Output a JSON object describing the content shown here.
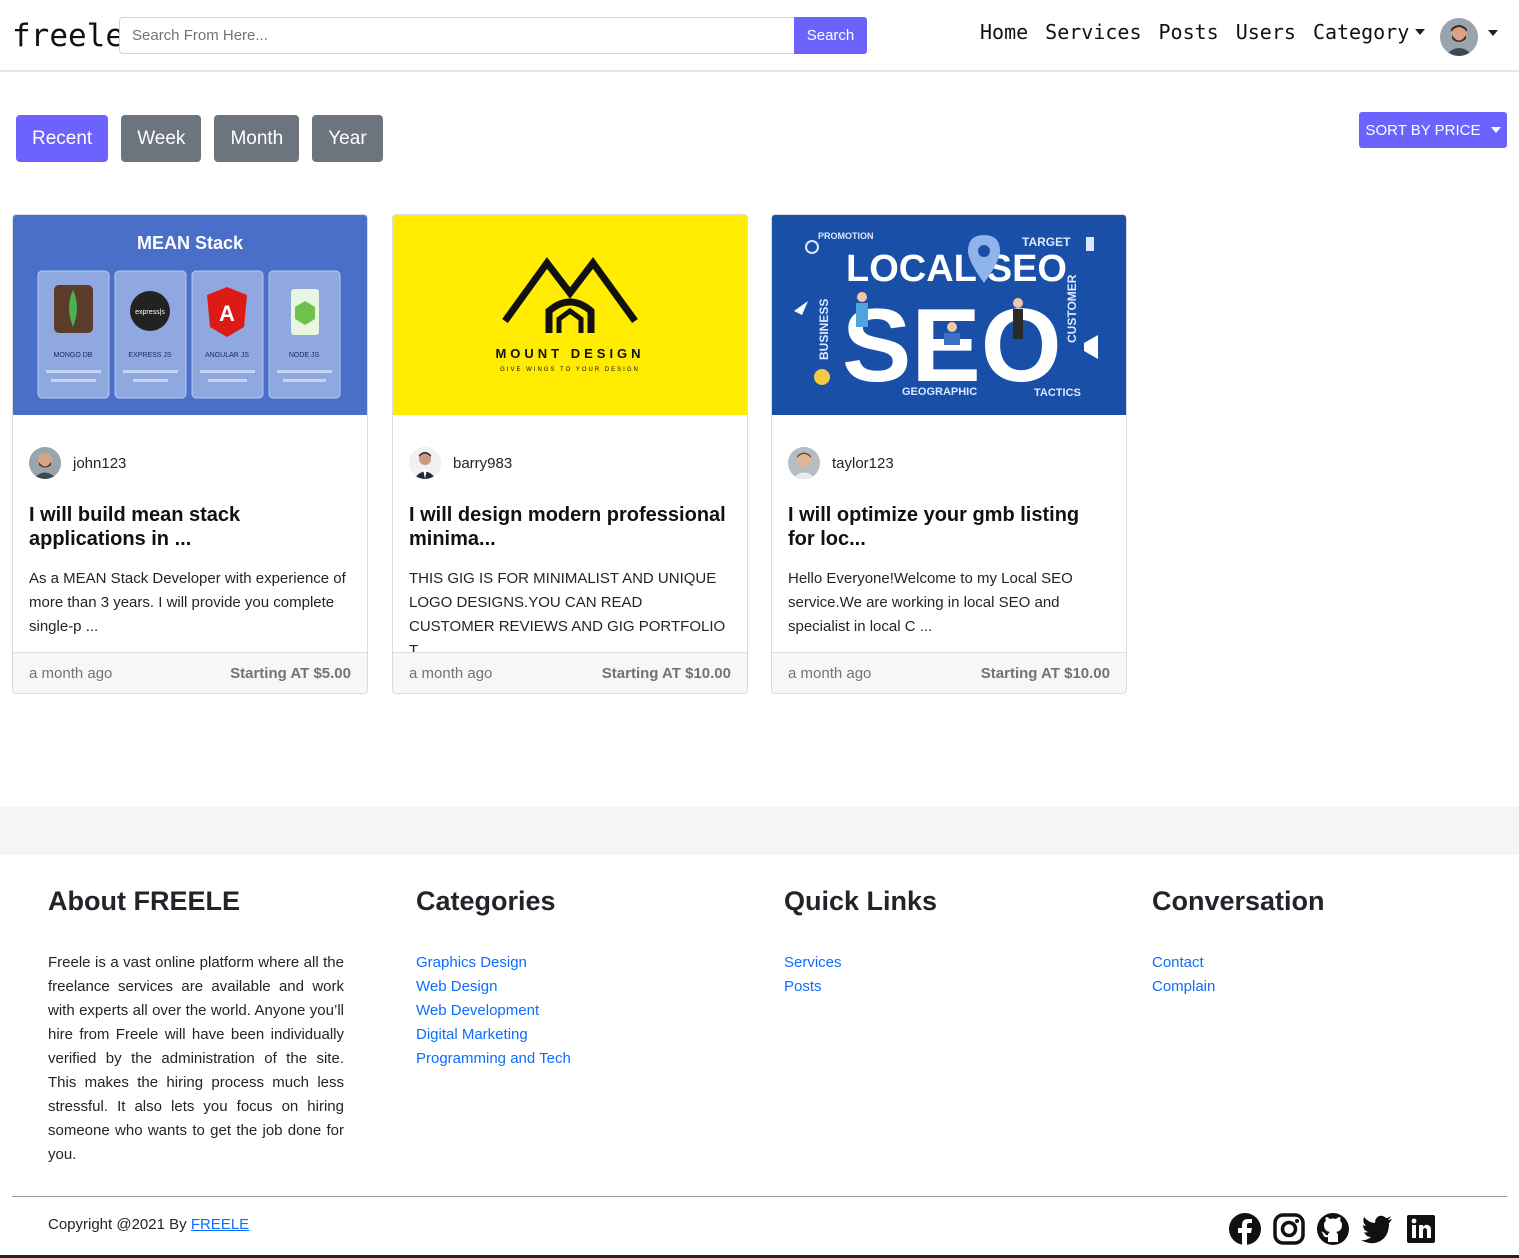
{
  "navbar": {
    "brand": "freele",
    "search_placeholder": "Search From Here...",
    "search_button": "Search",
    "links": [
      "Home",
      "Services",
      "Posts",
      "Users"
    ],
    "category_label": "Category"
  },
  "filters": {
    "buttons": [
      "Recent",
      "Week",
      "Month",
      "Year"
    ],
    "active": "Recent",
    "sort_label": "SORT BY PRICE"
  },
  "cards": [
    {
      "image_caption": "MEAN Stack",
      "image_items": [
        "MONGO DB",
        "EXPRESS JS",
        "ANGULAR JS",
        "NODE JS"
      ],
      "seller": "john123",
      "title": "I will build mean stack applications in ...",
      "description": "As a MEAN Stack Developer with experience of more than 3 years. I will provide you complete single-p ...",
      "time": "a month ago",
      "price": "Starting AT $5.00"
    },
    {
      "image_caption": "MOUNT DESIGN",
      "image_subcaption": "GIVE WINGS TO YOUR DESIGN",
      "seller": "barry983",
      "title": "I will design modern professional minima...",
      "description": "THIS GIG IS FOR MINIMALIST AND UNIQUE LOGO DESIGNS.YOU CAN READ CUSTOMER REVIEWS AND GIG PORTFOLIO T ...",
      "time": "a month ago",
      "price": "Starting AT $10.00"
    },
    {
      "image_caption": "LOCAL SEO",
      "image_words": [
        "PROMOTION",
        "TARGET",
        "BUSINESS",
        "CUSTOMER",
        "GEOGRAPHIC",
        "TACTICS"
      ],
      "seller": "taylor123",
      "title": "I will optimize your gmb listing for loc...",
      "description": "Hello Everyone!Welcome to my Local SEO service.We are working in local SEO and specialist in local C ...",
      "time": "a month ago",
      "price": "Starting AT $10.00"
    }
  ],
  "footer": {
    "about_title": "About FREELE",
    "about_text": "Freele is a vast online platform where all the freelance services are available and work with experts all over the world. Anyone you’ll hire from Freele will have been individually verified by the administration of the site. This makes the hiring process much less stressful. It also lets you focus on hiring someone who wants to get the job done for you.",
    "categories_title": "Categories",
    "categories": [
      "Graphics Design",
      "Web Design",
      "Web Development",
      "Digital Marketing",
      "Programming and Tech"
    ],
    "quick_title": "Quick Links",
    "quick_links": [
      "Services",
      "Posts"
    ],
    "conv_title": "Conversation",
    "conv_links": [
      "Contact",
      "Complain"
    ],
    "copyright_prefix": "Copyright @2021 By ",
    "copyright_link": "FREELE",
    "social_icons": [
      "facebook-icon",
      "instagram-icon",
      "github-icon",
      "twitter-icon",
      "linkedin-icon"
    ]
  },
  "colors": {
    "accent": "#6c63ff",
    "secondary": "#6c757d",
    "link": "#0d6efd",
    "card_mean_bg": "#4a6fc9",
    "card_mount_bg": "#ffec00",
    "card_seo_bg": "#1a4fa8"
  }
}
